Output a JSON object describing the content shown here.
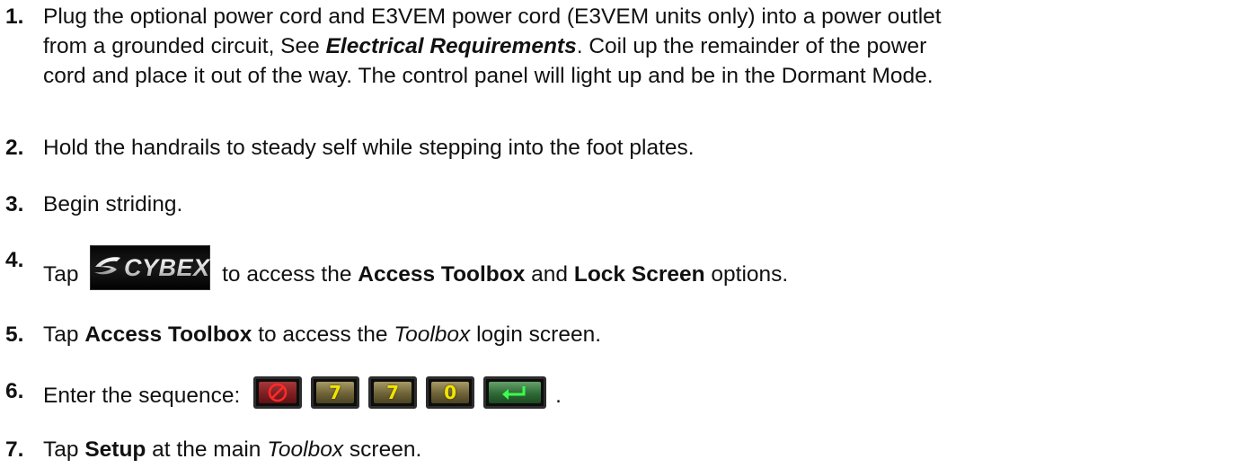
{
  "steps": [
    {
      "number": "1.",
      "line1_pre": "Plug the optional power cord and E3VEM power cord (E3VEM units only) into a power outlet",
      "line2_pre": "from a grounded circuit, See ",
      "line2_link": "Electrical Requirements",
      "line2_post": ". Coil up the remainder of the power",
      "line3": "cord and place it out of the way. The control panel will light up and be in the Dormant Mode."
    },
    {
      "number": "2.",
      "text": "Hold the handrails to steady self while stepping into the foot plates."
    },
    {
      "number": "3.",
      "text": "Begin striding."
    },
    {
      "number": "4.",
      "pre": "Tap ",
      "logo_text": "CYBEX",
      "mid1": " to access the ",
      "bold1": "Access Toolbox",
      "mid2": " and ",
      "bold2": "Lock Screen",
      "post": " options."
    },
    {
      "number": "5.",
      "pre": "Tap ",
      "bold": "Access Toolbox",
      "mid": " to access the ",
      "italic": "Toolbox",
      "post": " login screen."
    },
    {
      "number": "6.",
      "pre": "Enter the sequence: ",
      "keys": [
        {
          "icon": "clear-icon",
          "color": "#8c2427"
        },
        {
          "label": "7",
          "color": "#6e6338"
        },
        {
          "label": "7",
          "color": "#6e6338"
        },
        {
          "label": "0",
          "color": "#6e6338"
        },
        {
          "icon": "enter-icon",
          "color": "#2e6a36"
        }
      ],
      "post": "."
    },
    {
      "number": "7.",
      "pre": "Tap ",
      "bold": "Setup",
      "mid": " at the main ",
      "italic": "Toolbox",
      "post": " screen."
    }
  ]
}
